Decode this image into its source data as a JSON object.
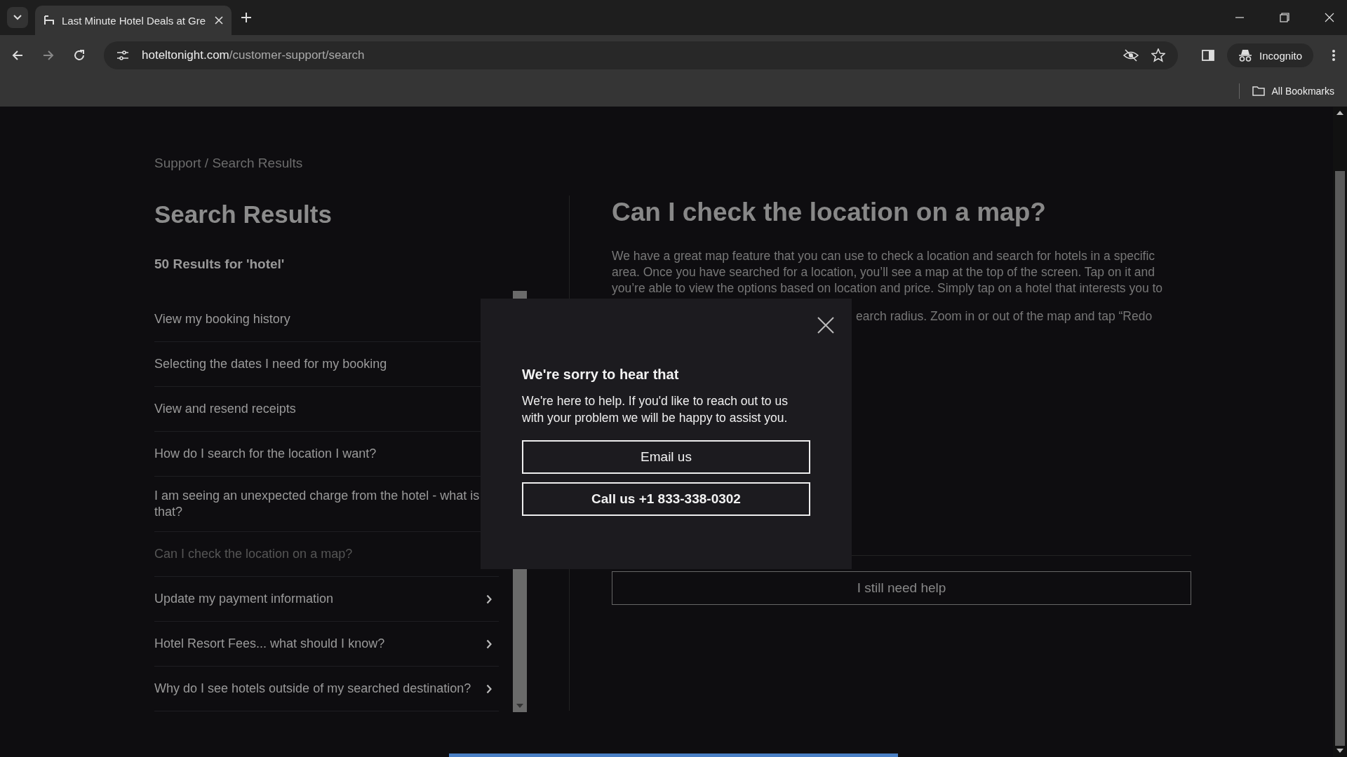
{
  "browser": {
    "tab_title": "Last Minute Hotel Deals at Gre",
    "url_host": "hoteltonight.com",
    "url_path": "/customer-support/search",
    "profile": "Incognito",
    "bookmarks": "All Bookmarks"
  },
  "breadcrumb": "Support / Search Results",
  "results": {
    "title": "Search Results",
    "count": "50 Results for 'hotel'",
    "items": [
      {
        "label": "View my booking history",
        "selected": false,
        "has_chevron": false
      },
      {
        "label": "Selecting the dates I need for my booking",
        "selected": false,
        "has_chevron": false
      },
      {
        "label": "View and resend receipts",
        "selected": false,
        "has_chevron": false
      },
      {
        "label": "How do I search for the location I want?",
        "selected": false,
        "has_chevron": false
      },
      {
        "label": "I am seeing an unexpected charge from the hotel - what is that?",
        "selected": false,
        "has_chevron": false
      },
      {
        "label": "Can I check the location on a map?",
        "selected": true,
        "has_chevron": false
      },
      {
        "label": "Update my payment information",
        "selected": false,
        "has_chevron": true
      },
      {
        "label": "Hotel Resort Fees... what should I know?",
        "selected": false,
        "has_chevron": true
      },
      {
        "label": "Why do I see hotels outside of my searched destination?",
        "selected": false,
        "has_chevron": true
      }
    ]
  },
  "article": {
    "title": "Can I check the location on a map?",
    "lines": [
      "We have a great map feature that you can use to check a location and search for hotels in a specific",
      "area. Once you have searched for a location, you’ll see a map at the top of the screen. Tap on it and",
      "you’re able to view the options based on location and price. Simply tap on a hotel that interests you to"
    ],
    "partial_line": "earch radius. Zoom in or out of the map and tap “Redo",
    "help_button": "I still need help"
  },
  "modal": {
    "title": "We're sorry to hear that",
    "body": "We're here to help. If you'd like to reach out to us with your problem we will be happy to assist you.",
    "buttons": [
      {
        "label": "Email us",
        "kind": "plain"
      },
      {
        "label": "Call us +1 833-338-0302",
        "kind": "strong"
      }
    ]
  }
}
